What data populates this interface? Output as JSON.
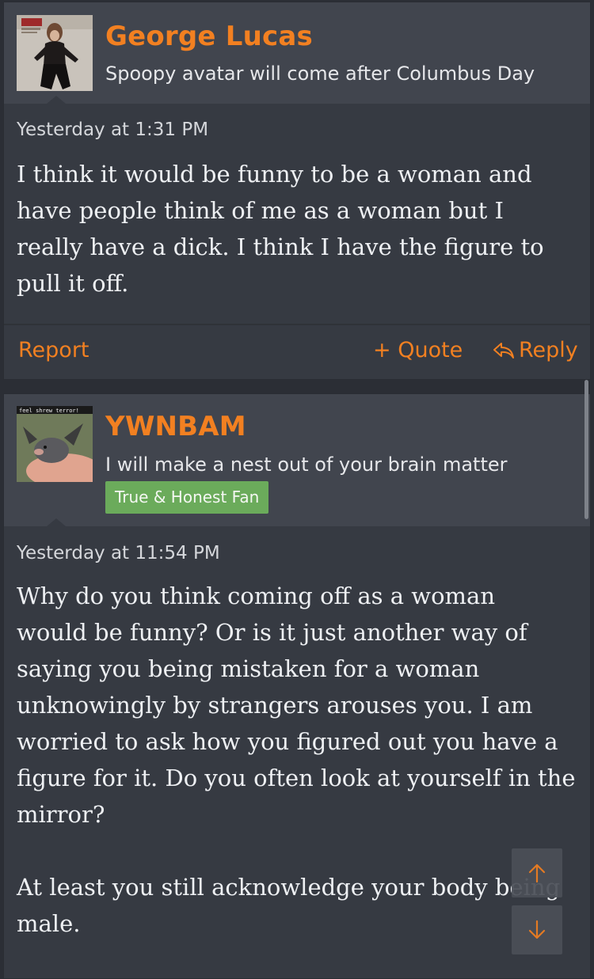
{
  "posts": [
    {
      "username": "George Lucas",
      "user_title": "Spoopy avatar will come after Columbus Day",
      "timestamp": "Yesterday at 1:31 PM",
      "message_lines": [
        "I think it would be funny to be a woman and",
        "have people think of me as a woman but I",
        "really have a dick. I think I have the figure to",
        "pull it off."
      ],
      "actions": {
        "report": "Report",
        "quote": "+ Quote",
        "reply": "Reply"
      }
    },
    {
      "username": "YWNBAM",
      "user_title": "I will make a nest out of your brain matter",
      "badge": "True & Honest Fan",
      "avatar_caption": "feel shrew terror!",
      "timestamp": "Yesterday at 11:54 PM",
      "message_lines": [
        "Why do you think coming off as a woman",
        "would be funny? Or is it just another way of",
        "saying you being mistaken for a woman",
        "unknowingly by strangers arouses you. I am",
        "worried to ask how you figured out you have a",
        "figure for it. Do you often look at yourself in the",
        "mirror?",
        "",
        "At least you still acknowledge your body being",
        "male."
      ]
    }
  ],
  "colors": {
    "accent": "#f28021",
    "badge": "#6bab5b",
    "post_bg": "#363a42",
    "header_bg": "#41454e"
  },
  "icons": {
    "reply": "reply-arrow-icon",
    "scroll_up": "arrow-up-icon",
    "scroll_down": "arrow-down-icon"
  }
}
